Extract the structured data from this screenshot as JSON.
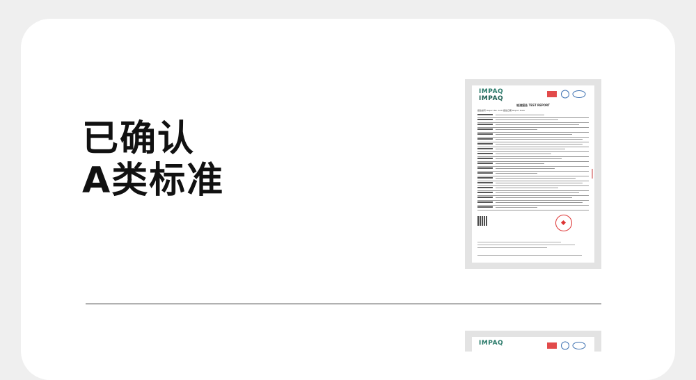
{
  "headline": {
    "line1": "已确认",
    "line2": "A类标准"
  },
  "certificate": {
    "logo_line1": "IMPAQ",
    "logo_line2": "IMPAQ",
    "report_title": "检测报告 TEST REPORT",
    "report_meta": "报告编号 Report No. SCH   报告日期 Report Date",
    "cert_marks": [
      "CMA",
      "ilac-MRA",
      "CNAS"
    ],
    "stamp_color": "#d33333",
    "logo_color": "#2a7a6a"
  },
  "certificate_2": {
    "logo": "IMPAQ"
  }
}
